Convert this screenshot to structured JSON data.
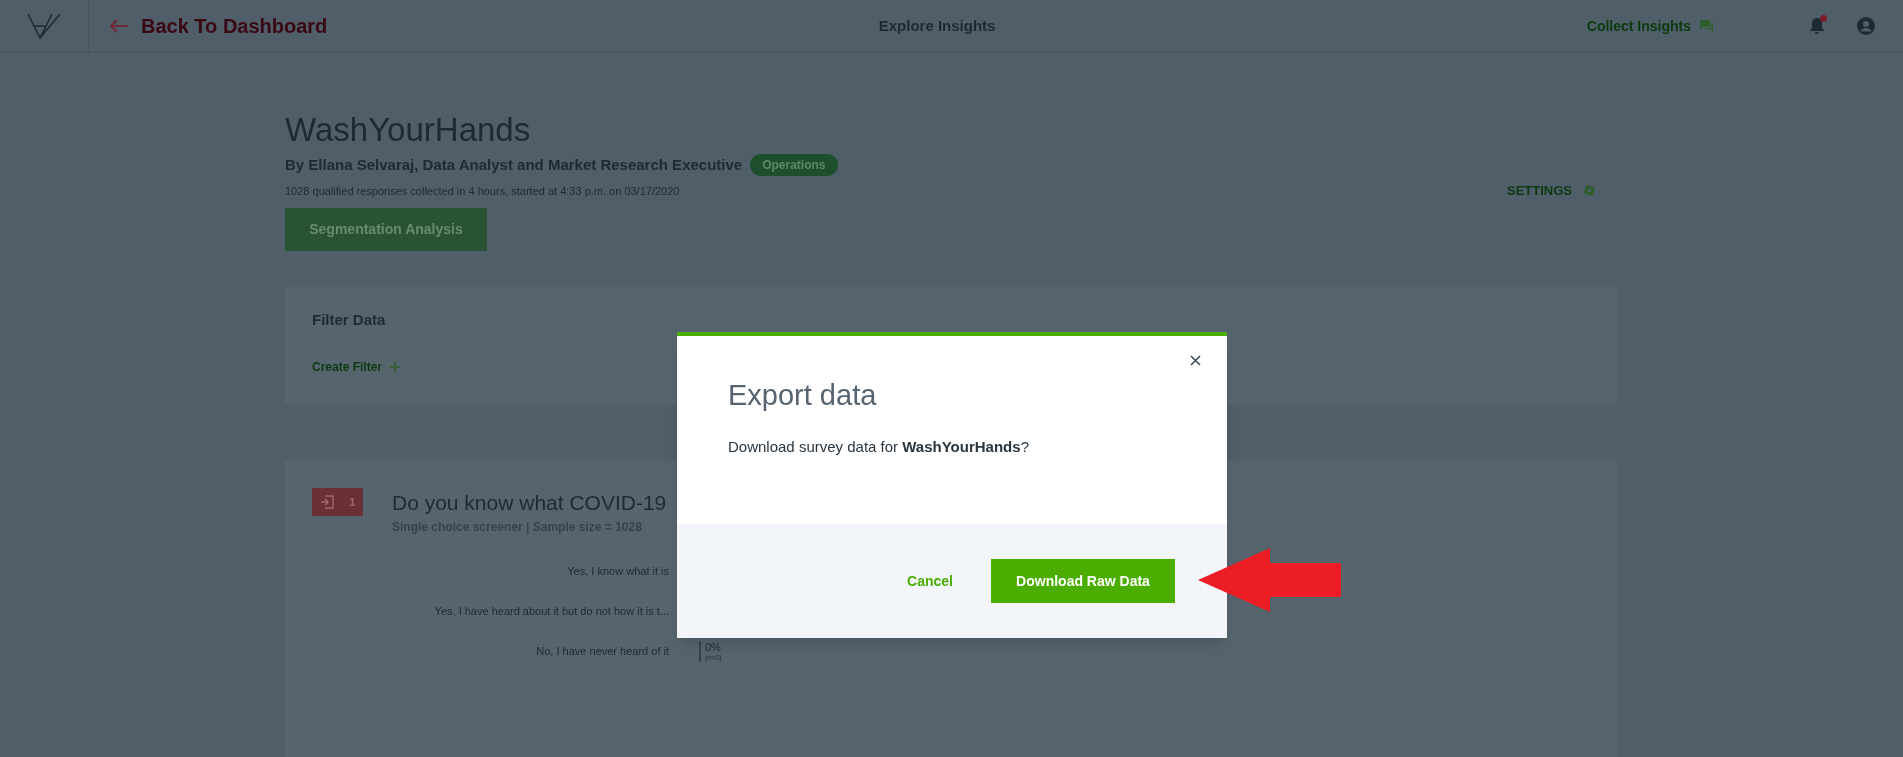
{
  "top_bar": {
    "back_link": "Back To Dashboard",
    "title": "Explore Insights",
    "collect_link": "Collect Insights",
    "notification_dot": true
  },
  "survey": {
    "title": "WashYourHands",
    "byline": "By Ellana Selvaraj, Data Analyst and Market Research Executive",
    "badge": "Operations",
    "summary": "1028 qualified responses collected in 4 hours, started at 4:33 p.m. on 03/17/2020",
    "segmentation_button": "Segmentation Analysis",
    "settings_link": "SETTINGS"
  },
  "filter_panel": {
    "title": "Filter Data",
    "create_filter": "Create Filter"
  },
  "question": {
    "number": "1",
    "title": "Do you know what COVID-19",
    "subtitle": "Single choice screener | Sample size = 1028",
    "answers": [
      {
        "label": "Yes, I know what it is"
      },
      {
        "label": "Yes, I have heard about it but do not how it is t..."
      },
      {
        "label": "No, I have never heard of it",
        "percent": "0%",
        "count": "(n=0)"
      }
    ]
  },
  "modal": {
    "title": "Export data",
    "message": "Download survey data for **WashYourHands**?",
    "cancel": "Cancel",
    "confirm": "Download Raw Data"
  }
}
